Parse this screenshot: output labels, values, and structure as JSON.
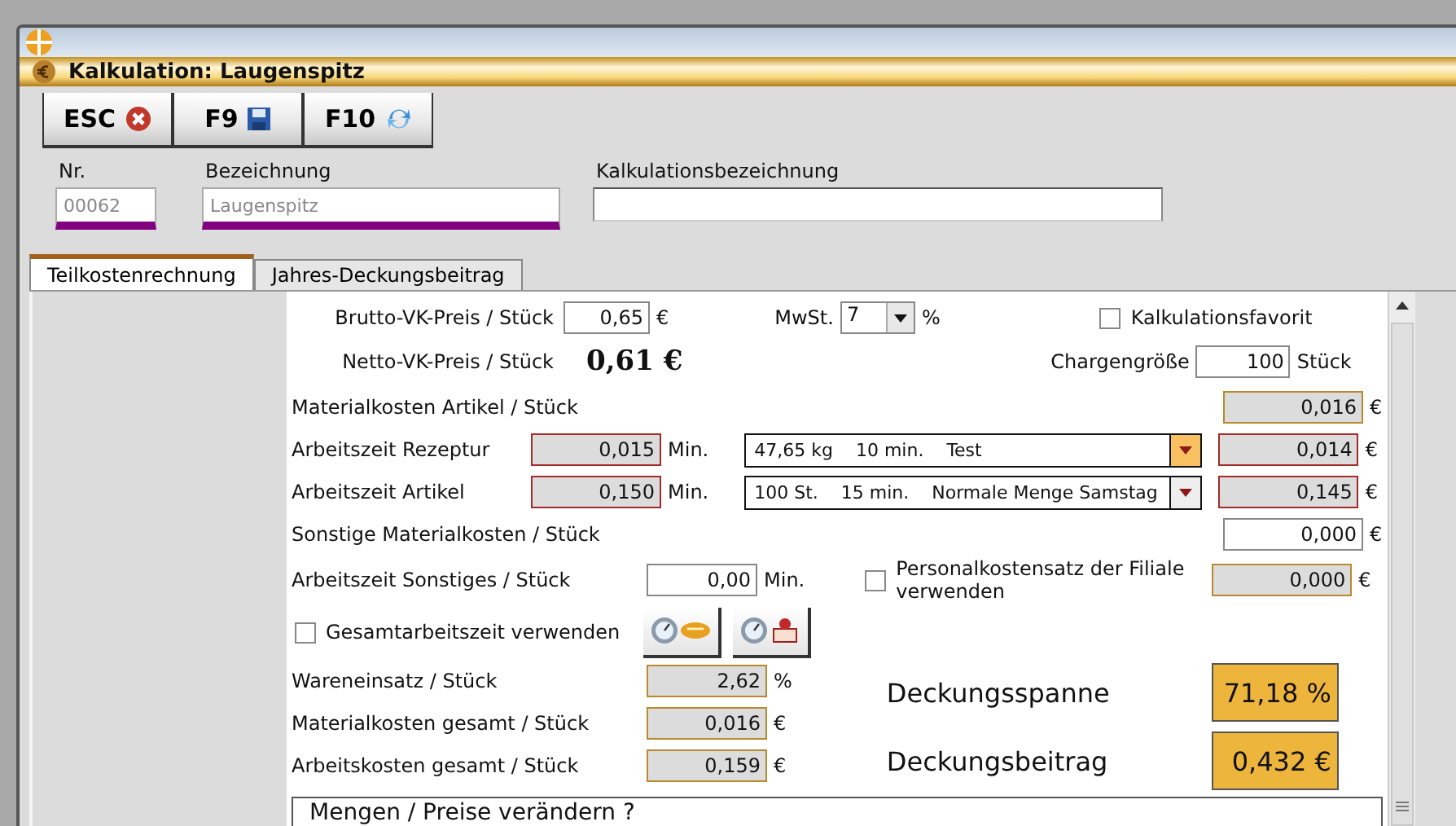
{
  "window": {
    "title": "Kalkulation: Laugenspitz"
  },
  "toolbar": [
    {
      "key": "ESC",
      "kind": "close"
    },
    {
      "key": "F9",
      "kind": "save"
    },
    {
      "key": "F10",
      "kind": "refresh"
    }
  ],
  "header_fields": [
    {
      "label": "Nr.",
      "value": "00062",
      "required": true,
      "disabled": true
    },
    {
      "label": "Bezeichnung",
      "value": "Laugenspitz",
      "required": true,
      "disabled": true
    },
    {
      "label": "Kalkulationsbezeichnung",
      "required": false,
      "disabled": false
    }
  ],
  "tabs": [
    {
      "label": "Teilkostenrechnung",
      "selected": true
    },
    {
      "label": "Jahres-Deckungsbeitrag",
      "selected": false
    }
  ],
  "pricing": {
    "brutto_label": "Brutto-VK-Preis / Stück",
    "brutto_value": "0,65",
    "brutto_unit": "€",
    "vat_label": "MwSt.",
    "vat_value": "7",
    "vat_unit": "%",
    "favorite_label": "Kalkulationsfavorit",
    "favorite_checked": false,
    "netto_label": "Netto-VK-Preis / Stück",
    "netto_value": "0,61 €",
    "batch_label": "Chargengröße",
    "batch_value": "100",
    "batch_unit": "Stück"
  },
  "cost_rows": [
    {
      "kind": "value",
      "label": "Materialkosten Artikel / Stück",
      "result": "0,016",
      "result_unit": "€",
      "result_linked": false,
      "result_editable": false
    },
    {
      "kind": "time",
      "label": "Arbeitszeit Rezeptur",
      "minutes": "0,015",
      "minutes_unit": "Min.",
      "combo": {
        "parts": [
          "47,65 kg",
          "10 min.",
          "Test"
        ],
        "highlighted": true
      },
      "result": "0,014",
      "result_unit": "€",
      "result_linked": true,
      "result_editable": false
    },
    {
      "kind": "time",
      "label": "Arbeitszeit Artikel",
      "minutes": "0,150",
      "minutes_unit": "Min.",
      "combo": {
        "parts": [
          "100 St.",
          "15 min.",
          "Normale Menge Samstag"
        ],
        "highlighted": false
      },
      "result": "0,145",
      "result_unit": "€",
      "result_linked": true,
      "result_editable": false
    },
    {
      "kind": "value",
      "label": "Sonstige Materialkosten / Stück",
      "result": "0,000",
      "result_unit": "€",
      "result_linked": false,
      "result_editable": true
    },
    {
      "kind": "other_time",
      "label": "Arbeitszeit Sonstiges / Stück",
      "minutes": "0,00",
      "minutes_unit": "Min.",
      "option": {
        "label": "Personalkostensatz der Filiale verwenden",
        "checked": false
      },
      "result": "0,000",
      "result_unit": "€",
      "result_linked": false,
      "result_editable": false
    }
  ],
  "total_time": {
    "label": "Gesamtarbeitszeit verwenden",
    "checked": false
  },
  "summary": [
    {
      "label": "Wareneinsatz / Stück",
      "value": "2,62",
      "unit": "%"
    },
    {
      "label": "Materialkosten gesamt / Stück",
      "value": "0,016",
      "unit": "€"
    },
    {
      "label": "Arbeitskosten gesamt / Stück",
      "value": "0,159",
      "unit": "€"
    }
  ],
  "margins": [
    {
      "label": "Deckungsspanne",
      "value": "71,18 %"
    },
    {
      "label": "Deckungsbeitrag",
      "value": "0,432 €"
    }
  ],
  "quantities_panel": {
    "title": "Mengen / Preise verändern ?"
  }
}
